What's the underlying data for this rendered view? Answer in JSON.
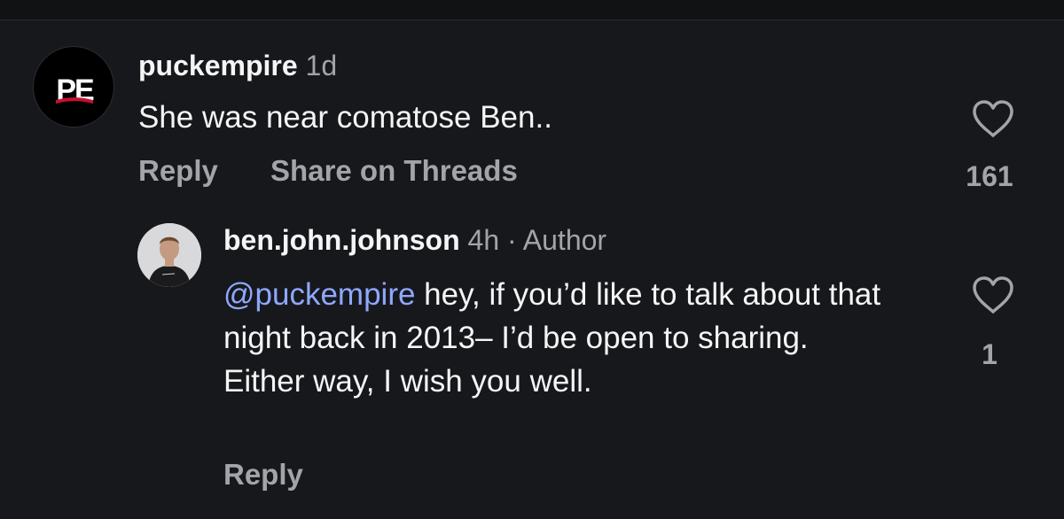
{
  "comments": [
    {
      "avatar": "puckempire-logo",
      "avatar_text": "PE",
      "username": "puckempire",
      "time": "1d",
      "text": "She was near comatose Ben..",
      "actions": {
        "reply": "Reply",
        "share": "Share on Threads"
      },
      "likes": "161",
      "heart_icon": "heart-outline-icon"
    }
  ],
  "reply": {
    "avatar": "ben-john-johnson-photo",
    "username": "ben.john.johnson",
    "time": "4h",
    "separator": "·",
    "badge": "Author",
    "mention": "@puckempire",
    "text": " hey, if you’d like to talk about that night back in 2013– I’d be open to sharing. Either way, I wish you well.",
    "actions": {
      "reply": "Reply"
    },
    "likes": "1",
    "heart_icon": "heart-outline-icon"
  },
  "colors": {
    "background": "#17181c",
    "primary_text": "#f5f5f5",
    "secondary_text": "#a2a4aa",
    "mention": "#8ea8ff"
  }
}
